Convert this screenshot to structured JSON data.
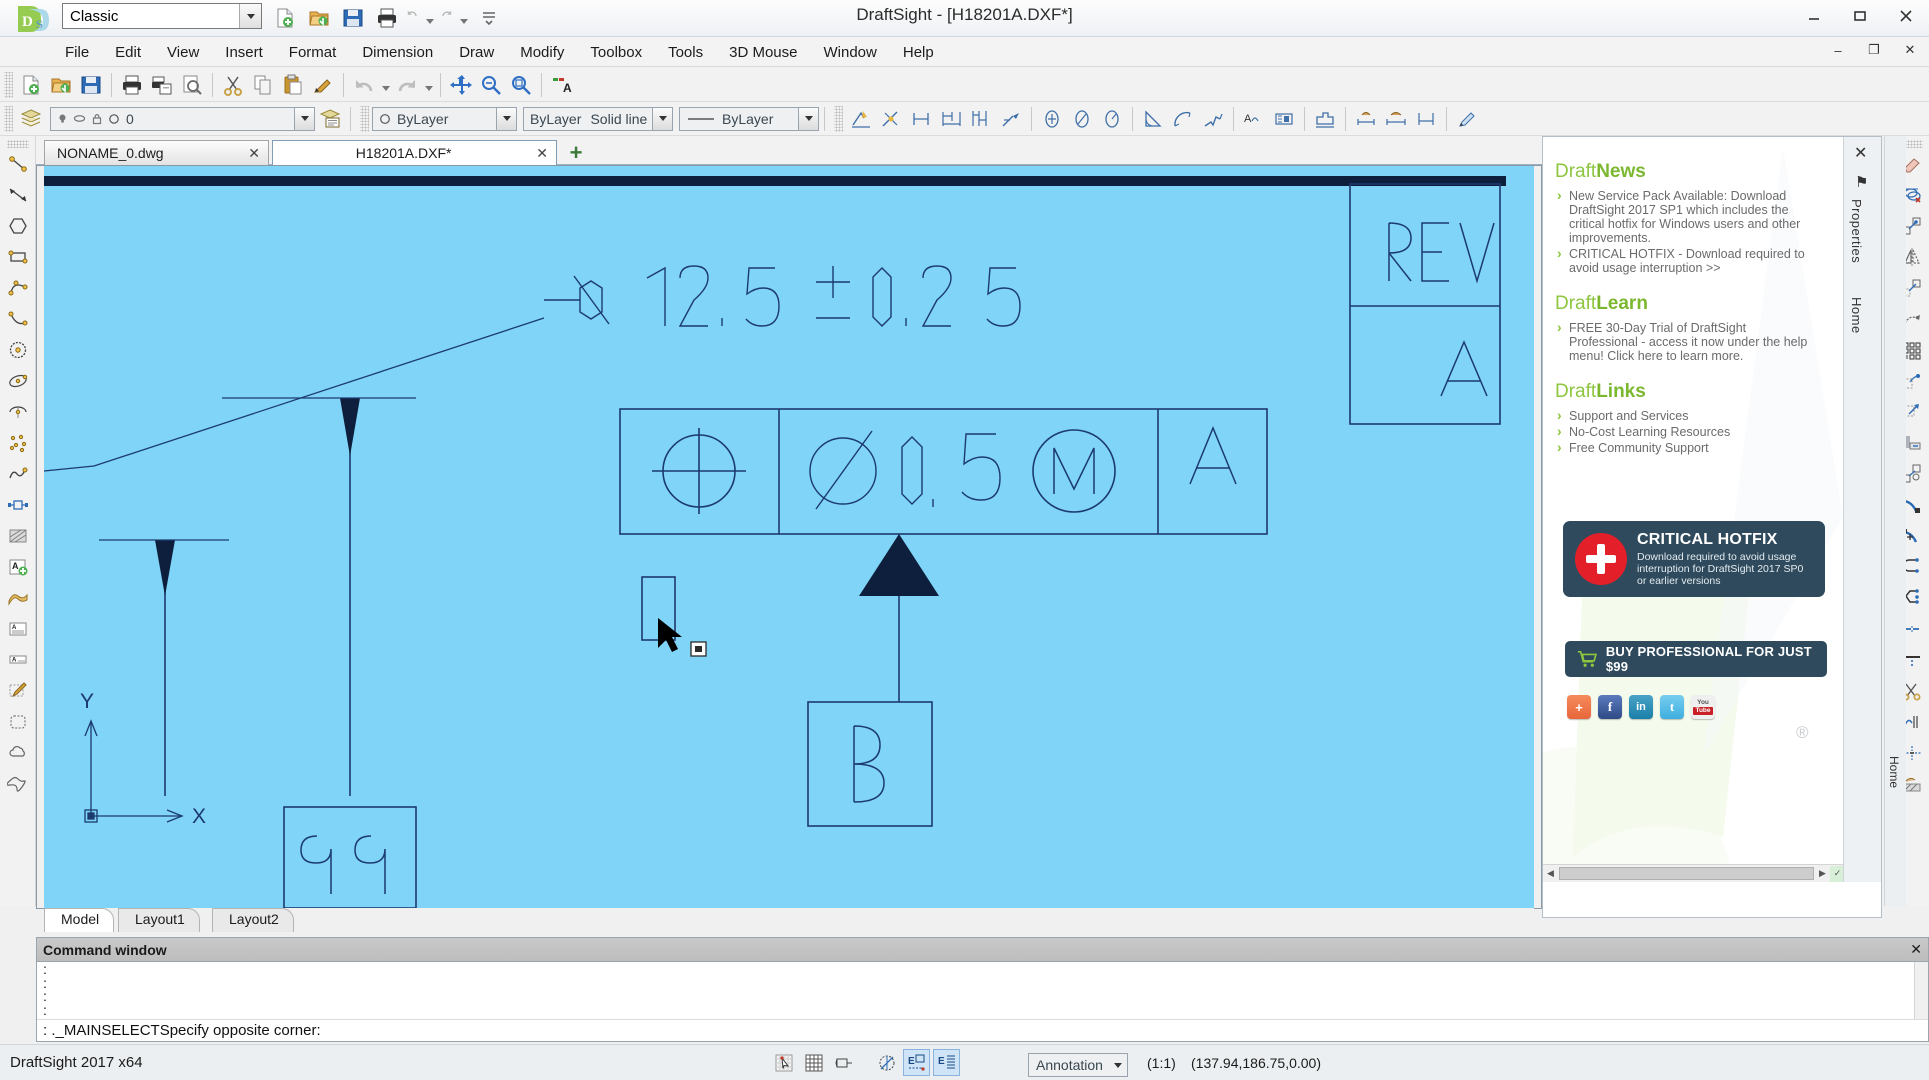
{
  "titlebar": {
    "app_title": "DraftSight - [H18201A.DXF*]",
    "workspace_value": "Classic",
    "quick_access": [
      {
        "name": "new-file-icon",
        "label": "New"
      },
      {
        "name": "open-file-icon",
        "label": "Open"
      },
      {
        "name": "save-icon",
        "label": "Save"
      },
      {
        "name": "print-icon",
        "label": "Print"
      },
      {
        "name": "undo-icon",
        "label": "Undo"
      },
      {
        "name": "redo-icon",
        "label": "Redo"
      },
      {
        "name": "customize-icon",
        "label": "Customize Quick Access Toolbar"
      }
    ],
    "window_buttons": [
      {
        "name": "minimize-button",
        "glyph": "–"
      },
      {
        "name": "maximize-button",
        "glyph": "❐"
      },
      {
        "name": "close-button",
        "glyph": "✕"
      }
    ]
  },
  "menubar": {
    "items": [
      {
        "label": "File",
        "acc": "F"
      },
      {
        "label": "Edit",
        "acc": "E"
      },
      {
        "label": "View",
        "acc": "V"
      },
      {
        "label": "Insert",
        "acc": "I"
      },
      {
        "label": "Format",
        "acc": "o"
      },
      {
        "label": "Dimension",
        "acc": "n"
      },
      {
        "label": "Draw",
        "acc": "D"
      },
      {
        "label": "Modify",
        "acc": "M"
      },
      {
        "label": "Toolbox",
        "acc": ""
      },
      {
        "label": "Tools",
        "acc": "T"
      },
      {
        "label": "3D Mouse",
        "acc": "3"
      },
      {
        "label": "Window",
        "acc": "W"
      },
      {
        "label": "Help",
        "acc": "H"
      }
    ],
    "doc_buttons": [
      {
        "name": "document-minimize-button",
        "glyph": "–"
      },
      {
        "name": "document-restore-button",
        "glyph": "❐"
      },
      {
        "name": "document-close-button",
        "glyph": "✕"
      }
    ]
  },
  "standard_toolbar": {
    "tools": [
      {
        "name": "new-drawing-icon",
        "label": "New"
      },
      {
        "name": "open-drawing-icon",
        "label": "Open"
      },
      {
        "name": "save-drawing-icon",
        "label": "Save"
      },
      {
        "name": "print-icon",
        "label": "Print"
      },
      {
        "name": "print-multiple-icon",
        "label": "Batch Print"
      },
      {
        "name": "print-preview-icon",
        "label": "Print Preview"
      },
      {
        "name": "cut-icon",
        "label": "Cut"
      },
      {
        "name": "copy-icon",
        "label": "Copy"
      },
      {
        "name": "paste-icon",
        "label": "Paste"
      },
      {
        "name": "paint-format-icon",
        "label": "Format Painter"
      },
      {
        "name": "undo-icon",
        "label": "Undo"
      },
      {
        "name": "redo-icon",
        "label": "Redo"
      },
      {
        "name": "pan-icon",
        "label": "Pan"
      },
      {
        "name": "zoom-previous-icon",
        "label": "Zoom Previous"
      },
      {
        "name": "zoom-window-icon",
        "label": "Zoom Window"
      },
      {
        "name": "find-replace-icon",
        "label": "Find and Replace"
      }
    ]
  },
  "draw_toolbar": {
    "tools": [
      {
        "name": "quick-dimension-icon",
        "label": "Smart Dimension"
      },
      {
        "name": "linear-dimension-icon",
        "label": "Linear Dimension"
      },
      {
        "name": "aligned-dimension-icon",
        "label": "Aligned Dimension"
      },
      {
        "name": "baseline-dimension-icon",
        "label": "Baseline Dimension"
      },
      {
        "name": "continue-dimension-icon",
        "label": "Continue Dimension"
      },
      {
        "name": "leader-icon",
        "label": "Leader"
      },
      {
        "name": "center-mark-icon",
        "label": "Center Mark"
      },
      {
        "name": "diameter-dimension-icon",
        "label": "Diameter Dimension"
      },
      {
        "name": "radius-dimension-icon",
        "label": "Radius Dimension"
      },
      {
        "name": "angular-dimension-icon",
        "label": "Angular Dimension"
      },
      {
        "name": "arc-length-dimension-icon",
        "label": "Arc Length Dimension"
      },
      {
        "name": "jogged-dimension-icon",
        "label": "Jogged Dimension"
      },
      {
        "name": "tolerance-icon",
        "label": "Tolerance"
      },
      {
        "name": "datum-icon",
        "label": "Datum Feature"
      },
      {
        "name": "dimension-style-icon",
        "label": "Dimension Style"
      },
      {
        "name": "edit-dimension-icon",
        "label": "Edit Dimension"
      },
      {
        "name": "edit-dimension-text-icon",
        "label": "Edit Dimension Text"
      },
      {
        "name": "dimension-update-icon",
        "label": "Update Dimension"
      },
      {
        "name": "dimension-painter-icon",
        "label": "Dimension Painter"
      }
    ]
  },
  "properties_toolbar": {
    "layer_manager_label": "Layer Manager",
    "layer_value": "0",
    "line_color_value": "ByLayer",
    "line_style_value_left": "ByLayer",
    "line_style_value_right": "Solid line",
    "line_weight_value": "ByLayer"
  },
  "left_toolbar": {
    "tools": [
      {
        "name": "line-icon",
        "label": "Line"
      },
      {
        "name": "infinite-line-icon",
        "label": "Infinite Line"
      },
      {
        "name": "polygon-icon",
        "label": "Polygon"
      },
      {
        "name": "rectangle-icon",
        "label": "Rectangle"
      },
      {
        "name": "arc-icon",
        "label": "Arc"
      },
      {
        "name": "spline-icon",
        "label": "Spline"
      },
      {
        "name": "circle-icon",
        "label": "Circle"
      },
      {
        "name": "ellipse-icon",
        "label": "Ellipse"
      },
      {
        "name": "ellipse-arc-icon",
        "label": "Ellipse Arc"
      },
      {
        "name": "point-icon",
        "label": "Point"
      },
      {
        "name": "freehand-icon",
        "label": "Freehand"
      },
      {
        "name": "block-icon",
        "label": "Block"
      },
      {
        "name": "hatch-icon",
        "label": "Hatch"
      },
      {
        "name": "note-icon",
        "label": "Note"
      },
      {
        "name": "richline-icon",
        "label": "Rich Line"
      },
      {
        "name": "table-icon",
        "label": "Table"
      },
      {
        "name": "simple-note-icon",
        "label": "Simple Note"
      },
      {
        "name": "edit-annotation-icon",
        "label": "Edit Annotation"
      },
      {
        "name": "region-icon",
        "label": "Region"
      },
      {
        "name": "cloud-icon",
        "label": "Revision Cloud"
      },
      {
        "name": "boundary-icon",
        "label": "Boundary"
      }
    ]
  },
  "right_toolbar": {
    "tools": [
      {
        "name": "erase-icon",
        "label": "Delete"
      },
      {
        "name": "copy-entity-icon",
        "label": "Copy"
      },
      {
        "name": "move-icon",
        "label": "Move"
      },
      {
        "name": "mirror-icon",
        "label": "Mirror"
      },
      {
        "name": "offset-icon",
        "label": "Offset"
      },
      {
        "name": "rotate-icon",
        "label": "Rotate"
      },
      {
        "name": "pattern-icon",
        "label": "Pattern"
      },
      {
        "name": "scale-icon",
        "label": "Scale"
      },
      {
        "name": "stretch-icon",
        "label": "Stretch"
      },
      {
        "name": "align-icon",
        "label": "Align"
      },
      {
        "name": "explode-icon",
        "label": "Explode"
      },
      {
        "name": "trim-icon",
        "label": "Trim"
      },
      {
        "name": "extend-icon",
        "label": "Extend"
      },
      {
        "name": "fillet-icon",
        "label": "Fillet"
      },
      {
        "name": "chamfer-icon",
        "label": "Chamfer"
      },
      {
        "name": "join-icon",
        "label": "Join"
      },
      {
        "name": "split-icon",
        "label": "Split"
      },
      {
        "name": "cut-entity-icon",
        "label": "Cut Entity"
      },
      {
        "name": "edit-polyline-icon",
        "label": "Edit PolyLine"
      },
      {
        "name": "edit-spline-icon",
        "label": "Edit Spline"
      },
      {
        "name": "edit-hatch-icon",
        "label": "Edit Hatch"
      }
    ]
  },
  "doc_tabs": {
    "tabs": [
      {
        "label": "NONAME_0.dwg",
        "close": "✕",
        "active": false
      },
      {
        "label": "H18201A.DXF*",
        "close": "✕",
        "active": true
      }
    ],
    "new_tab_glyph": "+"
  },
  "layout_tabs": {
    "tabs": [
      {
        "label": "Model",
        "active": true
      },
      {
        "label": "Layout1",
        "active": false
      },
      {
        "label": "Layout2",
        "active": false
      }
    ]
  },
  "drawing": {
    "background_color": "#7fd4f7",
    "line_color": "#1c3a6e",
    "dimension_text": "12.5",
    "dimension_symbol": "Ø",
    "tolerance_text": "±0.25",
    "gdt_symbol": "position",
    "gdt_tolerance": "Ø0.5",
    "gdt_modifier": "M",
    "gdt_datum": "A",
    "datum_label_b": "B",
    "revision_header": "REV",
    "revision_value": "A",
    "partial_text": "99"
  },
  "right_panel": {
    "close_glyph": "✕",
    "pin_glyph": "⚑",
    "vertical_tabs": [
      {
        "label": "Properties"
      },
      {
        "label": "Home"
      }
    ],
    "bottom_vertical_tab": "Home",
    "sections": [
      {
        "title_light": "Draft",
        "title_bold": "News",
        "items": [
          "New Service Pack Available: Download DraftSight 2017 SP1 which includes the critical hotfix for Windows users and other improvements.",
          "CRITICAL HOTFIX - Download required to avoid usage interruption >>"
        ]
      },
      {
        "title_light": "Draft",
        "title_bold": "Learn",
        "items": [
          "FREE 30-Day Trial of DraftSight Professional - access it now under the help menu! Click here to learn more."
        ]
      },
      {
        "title_light": "Draft",
        "title_bold": "Links",
        "items": [
          "Support and Services",
          "No-Cost Learning Resources",
          "Free Community Support"
        ]
      }
    ],
    "promo": {
      "headline": "CRITICAL HOTFIX",
      "body": "Download required to avoid usage interruption for DraftSight 2017 SP0 or earlier versions",
      "icon": "plus-circle-icon"
    },
    "buy_banner": {
      "label": "BUY PROFESSIONAL FOR JUST $99",
      "icon": "shopping-cart-icon"
    },
    "social": [
      {
        "name": "share-icon",
        "label": "+"
      },
      {
        "name": "facebook-icon",
        "label": "f"
      },
      {
        "name": "linkedin-icon",
        "label": "in"
      },
      {
        "name": "twitter-icon",
        "label": "t"
      },
      {
        "name": "youtube-icon",
        "label_top": "You",
        "label_bottom": "Tube"
      }
    ],
    "registered_mark": "®"
  },
  "command_window": {
    "title": "Command window",
    "close_glyph": "✕",
    "history": [
      ":",
      ":",
      ":",
      ":",
      ":"
    ],
    "prompt": ": ._MAINSELECTSpecify opposite corner:"
  },
  "statusbar": {
    "version": "DraftSight 2017 x64",
    "toggles": [
      {
        "name": "snap-toggle",
        "label": "Snap",
        "on": false
      },
      {
        "name": "grid-toggle",
        "label": "Grid",
        "on": false
      },
      {
        "name": "ortho-toggle",
        "label": "Ortho",
        "on": false
      },
      {
        "name": "polar-toggle",
        "label": "Polar",
        "on": false
      },
      {
        "name": "entity-snap-toggle",
        "label": "Entity Snap",
        "on": true
      },
      {
        "name": "entity-track-toggle",
        "label": "Entity Tracking",
        "on": true
      }
    ],
    "annotation_value": "Annotation",
    "scale_value": "(1:1)",
    "coordinates": "(137.94,186.75,0.00)"
  }
}
